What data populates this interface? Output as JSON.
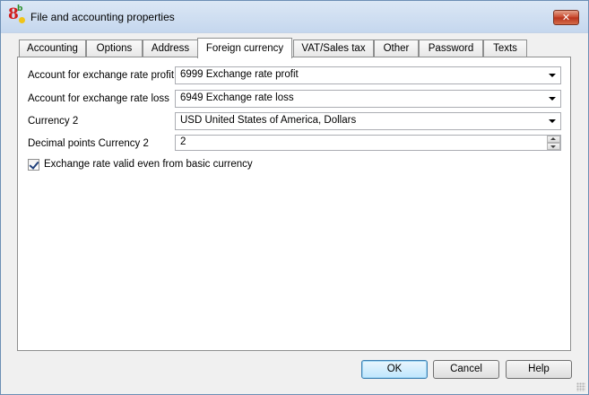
{
  "window": {
    "title": "File and accounting properties",
    "close_glyph": "✕",
    "icon_text_main": "8",
    "icon_text_small": "b"
  },
  "tabs": [
    {
      "label": "Accounting",
      "active": false
    },
    {
      "label": "Options",
      "active": false
    },
    {
      "label": "Address",
      "active": false
    },
    {
      "label": "Foreign currency",
      "active": true
    },
    {
      "label": "VAT/Sales tax",
      "active": false
    },
    {
      "label": "Other",
      "active": false
    },
    {
      "label": "Password",
      "active": false
    },
    {
      "label": "Texts",
      "active": false
    }
  ],
  "form": {
    "profit_label": "Account for exchange rate profit",
    "profit_value": "6999 Exchange rate profit",
    "loss_label": "Account for exchange rate loss",
    "loss_value": "6949 Exchange rate loss",
    "currency2_label": "Currency 2",
    "currency2_value": "USD United States of America, Dollars",
    "decimals_label": "Decimal points Currency 2",
    "decimals_value": "2",
    "checkbox_label": "Exchange rate valid even from basic currency",
    "checkbox_checked": true
  },
  "buttons": {
    "ok": "OK",
    "cancel": "Cancel",
    "help": "Help"
  }
}
